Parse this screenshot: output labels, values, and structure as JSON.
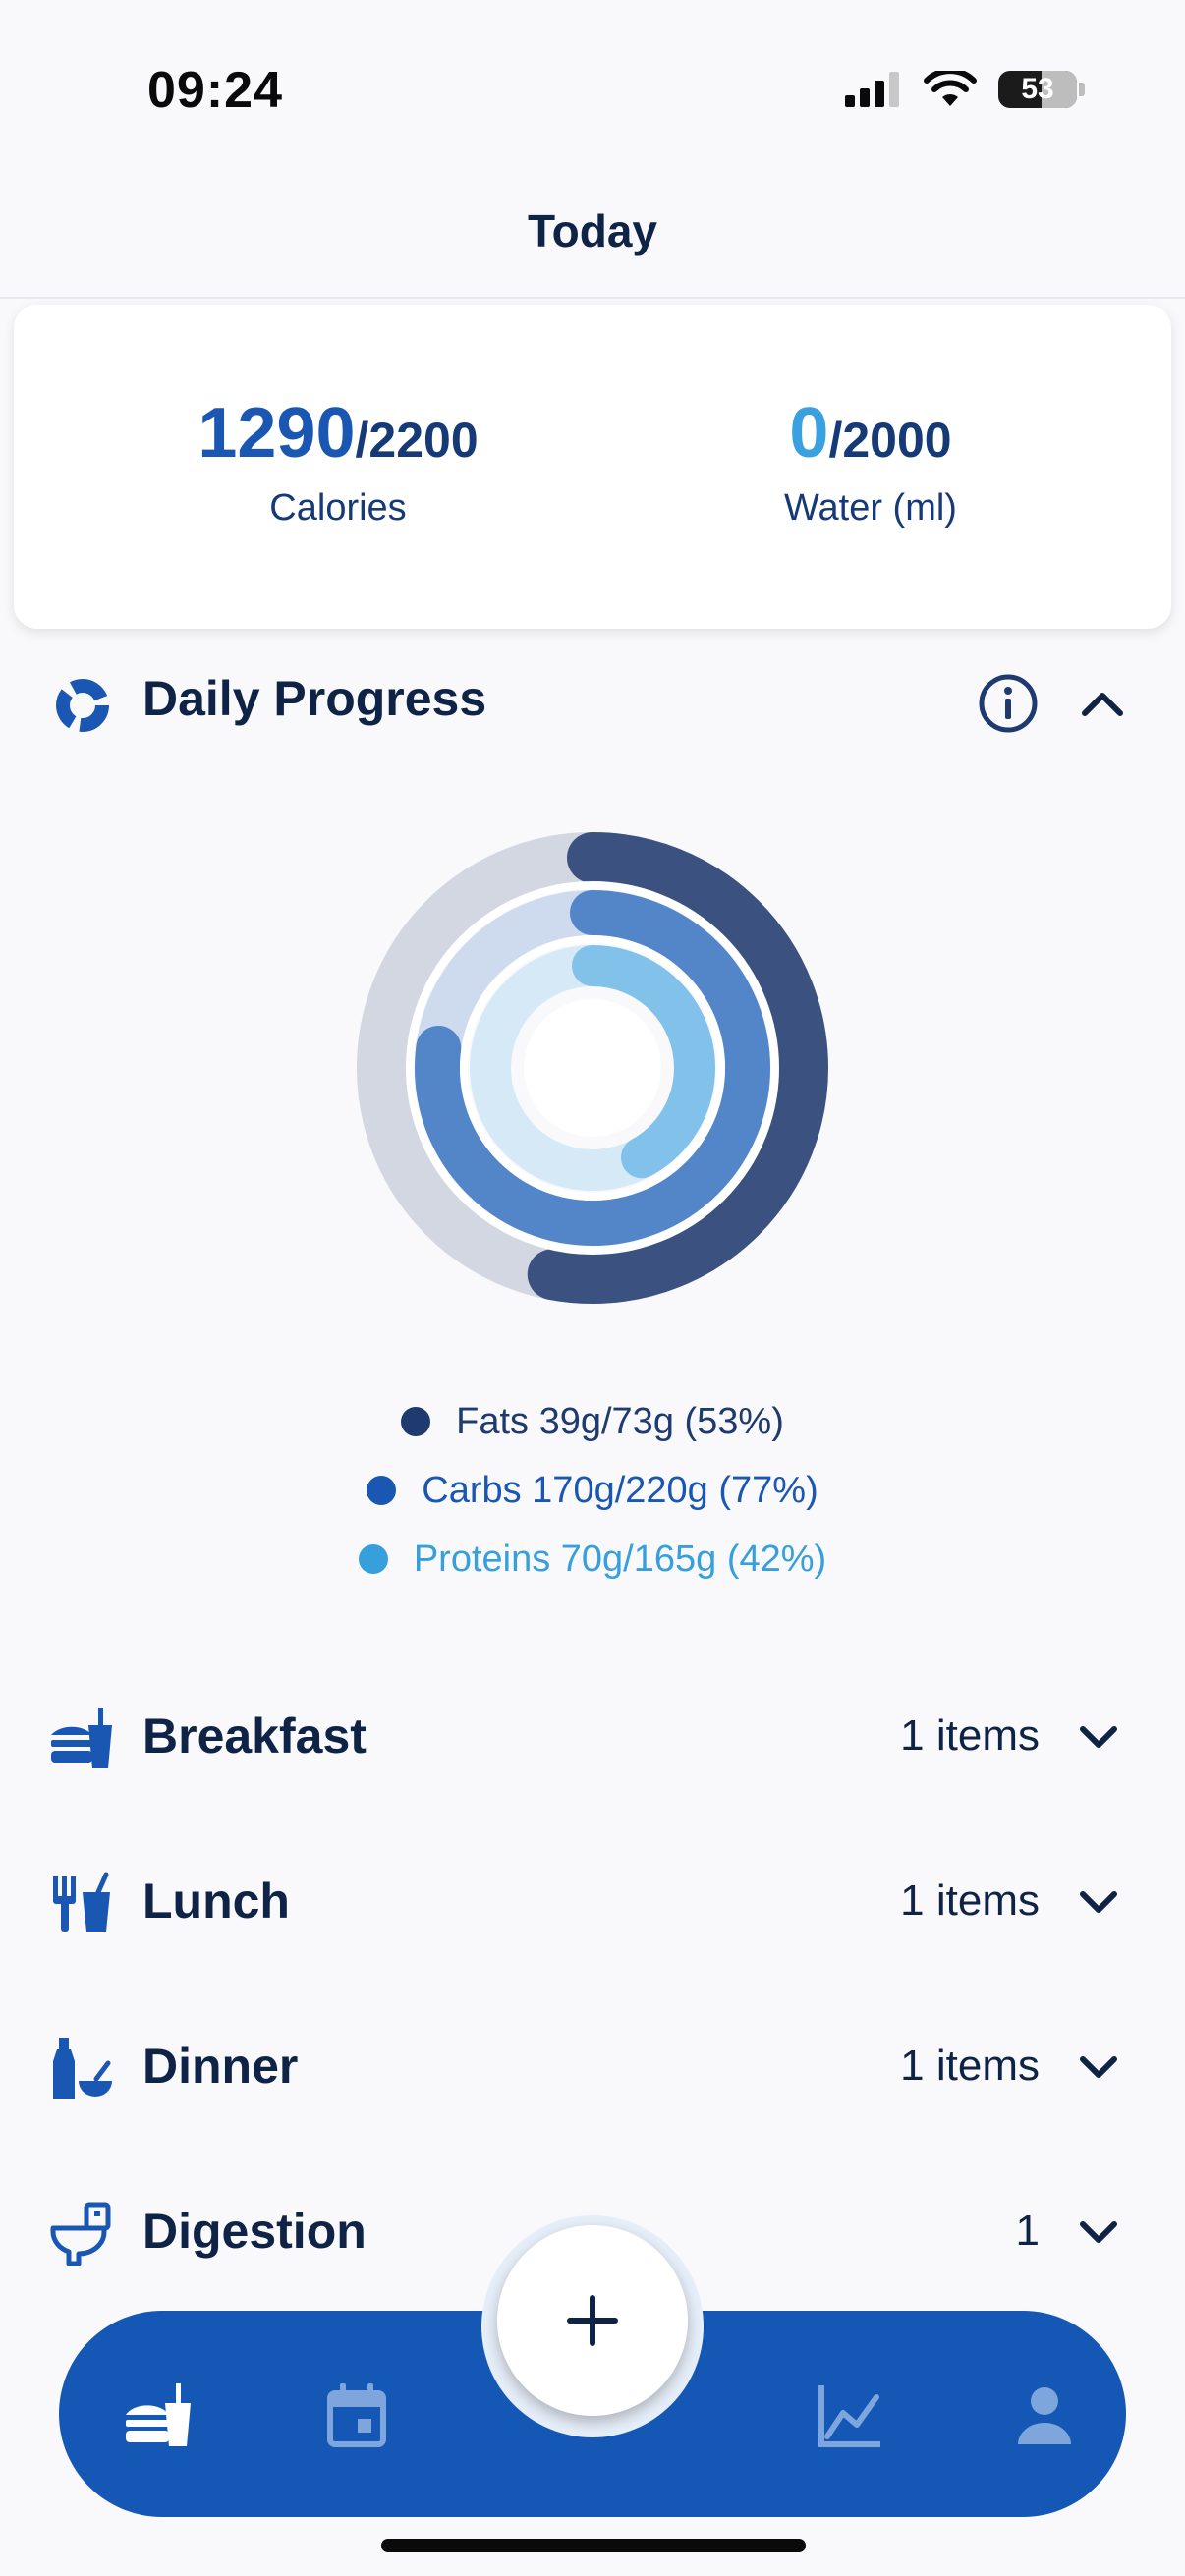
{
  "status_bar": {
    "time": "09:24",
    "battery": "53"
  },
  "header": {
    "title": "Today"
  },
  "summary": {
    "calories": {
      "value": "1290",
      "goal": "/2200",
      "label": "Calories"
    },
    "water": {
      "value": "0",
      "goal": "/2000",
      "label": "Water (ml)"
    }
  },
  "daily_progress": {
    "title": "Daily Progress",
    "rings": [
      {
        "name": "Fats",
        "fraction": 0.53,
        "color": "#3b5281",
        "track": "#d2d7e2"
      },
      {
        "name": "Carbs",
        "fraction": 0.77,
        "color": "#5385c9",
        "track": "#cedbee"
      },
      {
        "name": "Proteins",
        "fraction": 0.42,
        "color": "#82c2ea",
        "track": "#d5e9f7"
      }
    ],
    "legend": [
      {
        "text": "Fats 39g/73g (53%)",
        "dot": "#1f3a6e",
        "color": "#1f3a6e"
      },
      {
        "text": "Carbs 170g/220g (77%)",
        "dot": "#1a57b2",
        "color": "#1a57b2"
      },
      {
        "text": "Proteins 70g/165g (42%)",
        "dot": "#36a0dc",
        "color": "#36a0dc"
      }
    ]
  },
  "meals": [
    {
      "title": "Breakfast",
      "count": "1 items",
      "icon": "burger-icon"
    },
    {
      "title": "Lunch",
      "count": "1 items",
      "icon": "fork-knife-icon"
    },
    {
      "title": "Dinner",
      "count": "1 items",
      "icon": "bottle-bowl-icon"
    },
    {
      "title": "Digestion",
      "count": "1",
      "icon": "toilet-icon"
    }
  ],
  "bottom_nav": {
    "items": [
      "food-icon",
      "calendar-icon",
      "add-icon",
      "chart-icon",
      "profile-icon"
    ],
    "fab": "+"
  },
  "colors": {
    "primary": "#1557b5",
    "text": "#0f2347"
  }
}
